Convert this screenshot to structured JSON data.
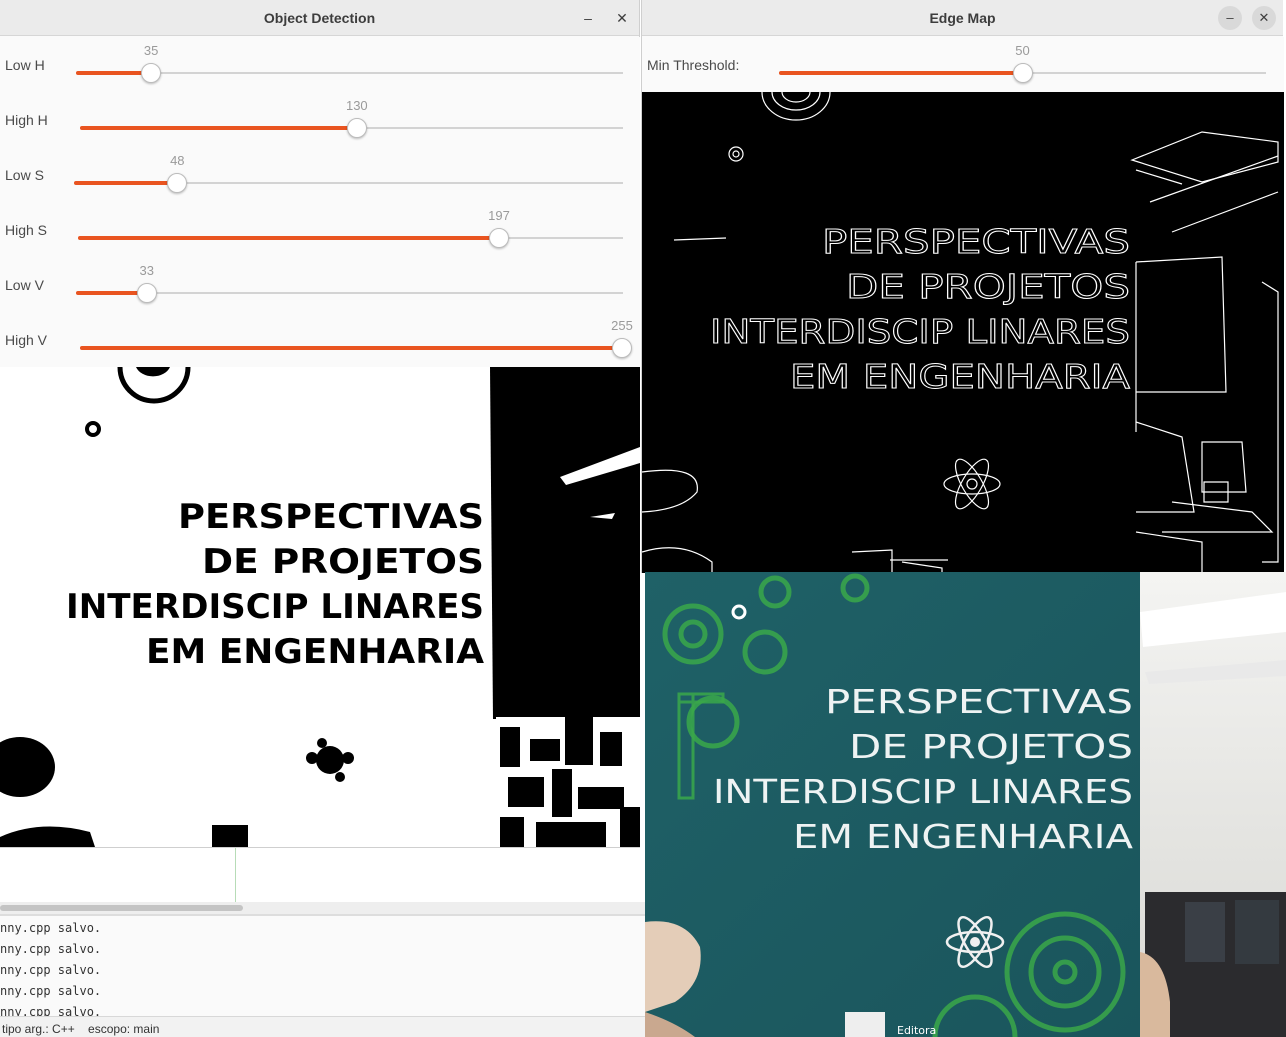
{
  "ide": {
    "log_lines": [
      "nny.cpp salvo.",
      "nny.cpp salvo.",
      "nny.cpp salvo.",
      "nny.cpp salvo.",
      "nny.cpp salvo."
    ],
    "status": "tipo arg.: C++    escopo: main"
  },
  "object_detection": {
    "title": "Object Detection",
    "minimize": "–",
    "close": "✕",
    "sliders": [
      {
        "label": "Low H",
        "value": "35",
        "fraction": 0.1373
      },
      {
        "label": "High H",
        "value": "130",
        "fraction": 0.5098
      },
      {
        "label": "Low S",
        "value": "48",
        "fraction": 0.1882
      },
      {
        "label": "High S",
        "value": "197",
        "fraction": 0.7725
      },
      {
        "label": "Low V",
        "value": "33",
        "fraction": 0.1294
      },
      {
        "label": "High V",
        "value": "255",
        "fraction": 1.0
      }
    ],
    "image_text": [
      "PERSPECTIVAS",
      "DE PROJETOS",
      "INTERDISCIP LINARES",
      "EM ENGENHARIA"
    ]
  },
  "edge_map": {
    "title": "Edge Map",
    "minimize": "–",
    "close": "✕",
    "slider": {
      "label": "Min Threshold:",
      "value": "50",
      "fraction": 0.5
    },
    "image_text": [
      "PERSPECTIVAS",
      "DE PROJETOS",
      "INTERDISCIP LINARES",
      "EM ENGENHARIA"
    ]
  },
  "camera": {
    "image_text": [
      "PERSPECTIVAS",
      "DE PROJETOS",
      "INTERDISCIP LINARES",
      "EM ENGENHARIA"
    ],
    "publisher_fragment": "Editora"
  },
  "colors": {
    "accent": "#e95420",
    "book": "#1e5e63",
    "gear_green": "#3aa84a"
  }
}
